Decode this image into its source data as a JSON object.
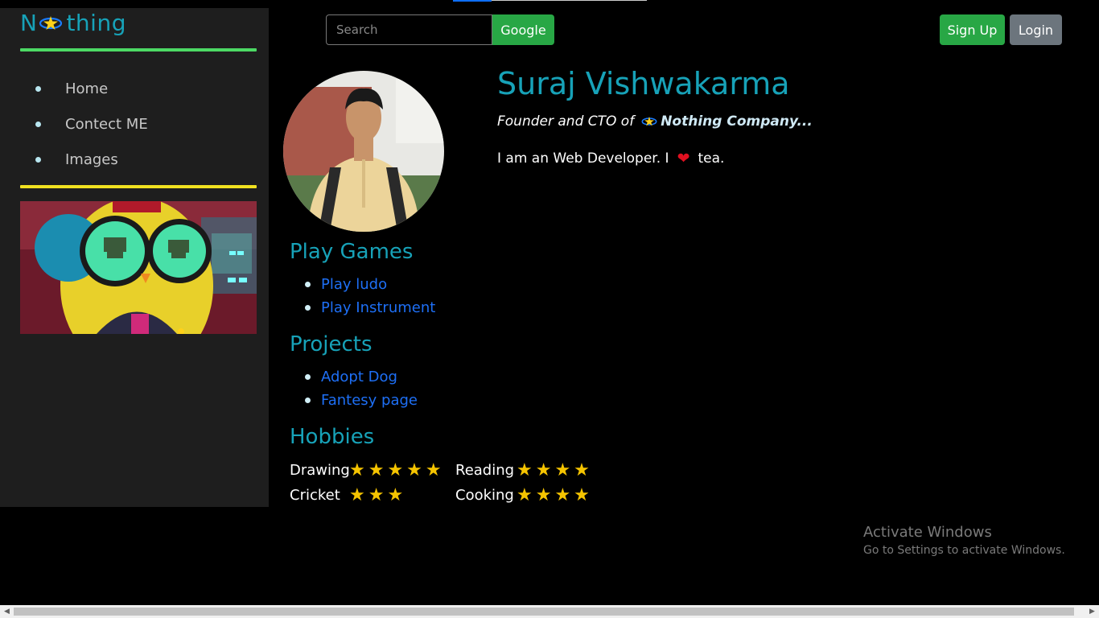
{
  "sidebar": {
    "logo_left": "N",
    "logo_right": "thing",
    "nav": [
      {
        "label": "Home"
      },
      {
        "label": "Contect ME"
      },
      {
        "label": "Images"
      }
    ]
  },
  "header": {
    "search_placeholder": "Search",
    "search_button": "Google",
    "signup": "Sign Up",
    "login": "Login"
  },
  "profile": {
    "name": "Suraj Vishwakarma",
    "tagline_prefix": "Founder and CTO of",
    "company": "Nothing Company...",
    "bio_before": "I am an Web Developer. I",
    "bio_after": "tea."
  },
  "sections": {
    "games": {
      "title": "Play Games",
      "items": [
        "Play ludo",
        "Play Instrument"
      ]
    },
    "projects": {
      "title": "Projects",
      "items": [
        "Adopt Dog",
        "Fantesy page"
      ]
    },
    "hobbies": {
      "title": "Hobbies",
      "items": [
        {
          "name": "Drawing",
          "stars": "★★★★★",
          "rating": 5
        },
        {
          "name": "Reading",
          "stars": "★★★★",
          "rating": 4
        },
        {
          "name": "Cricket",
          "stars": "★★★",
          "rating": 3
        },
        {
          "name": "Cooking",
          "stars": "★★★★",
          "rating": 4
        }
      ]
    }
  },
  "watermark": {
    "title": "Activate Windows",
    "subtitle": "Go to Settings to activate Windows."
  },
  "colors": {
    "accent": "#17a2b8",
    "success": "#28a745",
    "secondary": "#6c757d",
    "link": "#1e6ff5",
    "star": "#f5c400"
  }
}
